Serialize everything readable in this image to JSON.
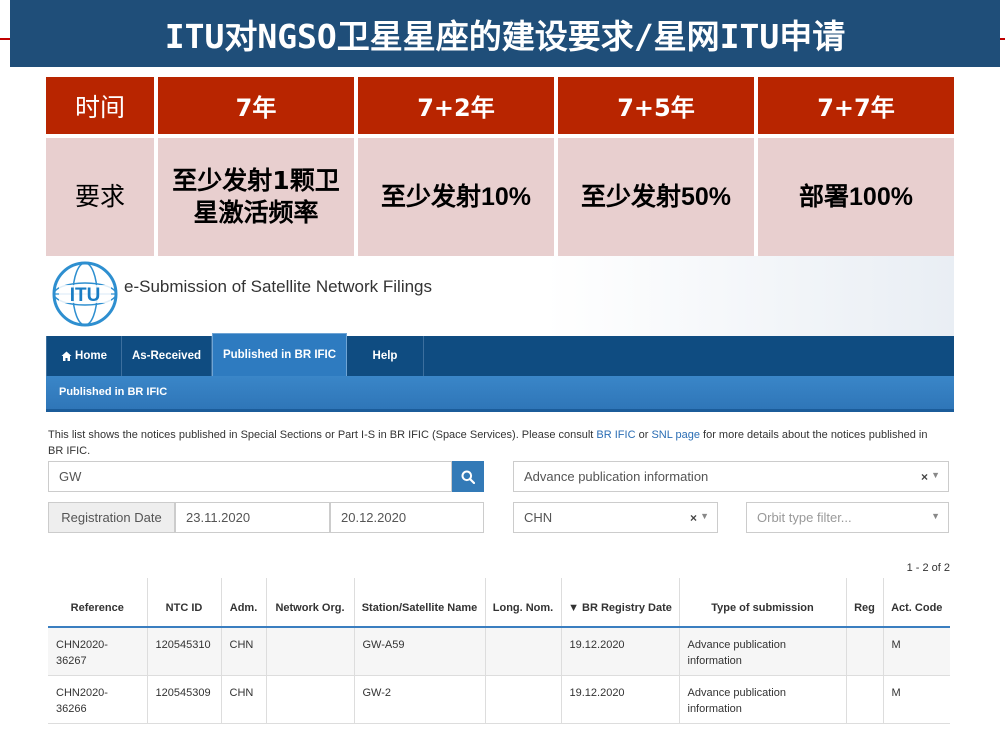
{
  "slide": {
    "title": "ITU对NGSO卫星星座的建设要求/星网ITU申请",
    "table": {
      "header": [
        "时间",
        "7年",
        "7+2年",
        "7+5年",
        "7+7年"
      ],
      "row": [
        {
          "text": "要求"
        },
        {
          "line1": "至少发射1颗卫",
          "line2": "星激活频率"
        },
        {
          "pre": "至少发射",
          "num": "10%"
        },
        {
          "pre": "至少发射",
          "num": "50%"
        },
        {
          "pre": "部署",
          "num": "100%"
        }
      ]
    }
  },
  "itu": {
    "logo_text": "ITU",
    "site_title": "e-Submission of Satellite Network Filings",
    "nav": {
      "home_icon": "home-icon",
      "home": "Home",
      "as_received": "As-Received",
      "published": "Published in BR IFIC",
      "help": "Help"
    },
    "subnav": "Published in BR IFIC",
    "description": {
      "part1": "This list shows the notices published in Special Sections or Part I-S in BR IFIC (Space Services). Please consult ",
      "link1": "BR IFIC",
      "part2": " or ",
      "link2": "SNL page",
      "part3": " for more details about the notices published in BR IFIC."
    },
    "filters": {
      "search_value": "GW",
      "search_icon": "search-icon",
      "type_value": "Advance publication information",
      "date_label": "Registration Date",
      "date_from": "23.11.2020",
      "date_to": "20.12.2020",
      "adm_value": "CHN",
      "orbit_placeholder": "Orbit type filter..."
    },
    "count": "1 - 2 of 2",
    "table": {
      "headers": [
        "Reference",
        "NTC ID",
        "Adm.",
        "Network Org.",
        "Station/Satellite Name",
        "Long. Nom.",
        "▼ BR Registry Date",
        "Type of submission",
        "Reg",
        "Act. Code"
      ],
      "rows": [
        {
          "reference": "CHN2020-36267",
          "ntc_id": "120545310",
          "adm": "CHN",
          "network_org": "",
          "name": "GW-A59",
          "long_nom": "",
          "date": "19.12.2020",
          "type": "Advance publication information",
          "reg": "",
          "act_code": "M"
        },
        {
          "reference": "CHN2020-36266",
          "ntc_id": "120545309",
          "adm": "CHN",
          "network_org": "",
          "name": "GW-2",
          "long_nom": "",
          "date": "19.12.2020",
          "type": "Advance publication information",
          "reg": "",
          "act_code": "M"
        }
      ]
    },
    "colors": {
      "nav": "#0f4c81",
      "accent": "#337ab7",
      "title_bar": "#1f4e79",
      "header_cell": "#b82500",
      "body_cell": "#e8cfcf"
    }
  }
}
